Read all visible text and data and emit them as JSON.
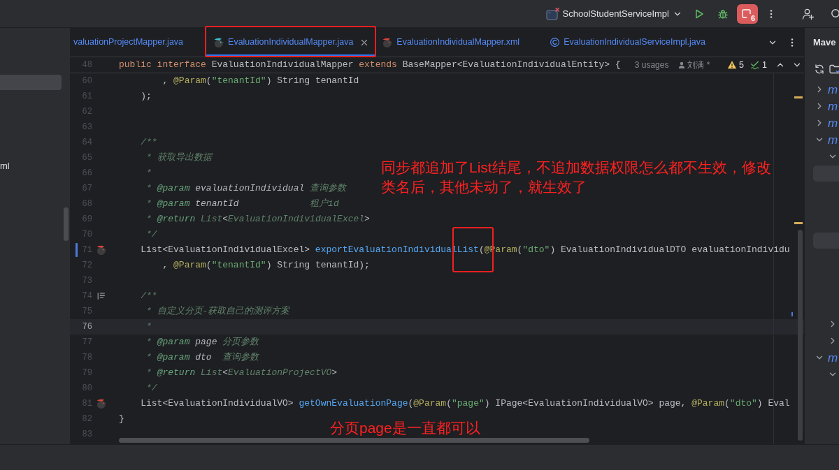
{
  "toolbar": {
    "run_configuration": "SchoolStudentServiceImpl",
    "stop_count": "6"
  },
  "project_panel": {
    "rows": [
      {
        "selected": true
      },
      {
        "selected": false
      },
      {
        "selected": false
      },
      {
        "selected": false
      },
      {
        "selected": false
      },
      {
        "label": "ml",
        "selected": false
      }
    ]
  },
  "editor_tabs": [
    {
      "label": "valuationProjectMapper.java",
      "kind": "plain",
      "selected": false,
      "framed": false
    },
    {
      "label": "EvaluationIndividualMapper.java",
      "kind": "mapper",
      "selected": true,
      "framed": true
    },
    {
      "label": "EvaluationIndividualMapper.xml",
      "kind": "mapper-xml",
      "selected": false,
      "framed": false
    },
    {
      "label": "EvaluationIndividualServiceImpl.java",
      "kind": "class",
      "selected": false,
      "framed": false
    }
  ],
  "sticky_line": {
    "number": "48",
    "segments": [
      {
        "kind": "keyword",
        "text": "public interface "
      },
      {
        "kind": "plain",
        "text": "EvaluationIndividualMapper "
      },
      {
        "kind": "keyword",
        "text": "extends "
      },
      {
        "kind": "plain",
        "text": "BaseMapper<EvaluationIndividualEntity> {"
      }
    ],
    "usages": "3 usages",
    "author": "刘满 *"
  },
  "inspections": {
    "warnings": "5",
    "passed": "1"
  },
  "lines": [
    {
      "number": "60",
      "current": false,
      "changed": false,
      "segments": [
        {
          "kind": "plain",
          "text": "        , "
        },
        {
          "kind": "annotation",
          "text": "@Param"
        },
        {
          "kind": "plain",
          "text": "("
        },
        {
          "kind": "string",
          "text": "\"tenantId\""
        },
        {
          "kind": "plain",
          "text": ") String tenantId"
        }
      ]
    },
    {
      "number": "61",
      "current": false,
      "changed": false,
      "segments": [
        {
          "kind": "plain",
          "text": "    );"
        }
      ]
    },
    {
      "number": "62",
      "current": false,
      "changed": false
    },
    {
      "number": "63",
      "current": false,
      "changed": false
    },
    {
      "number": "64",
      "current": false,
      "changed": false,
      "segments": [
        {
          "kind": "doc",
          "text": "    /**"
        }
      ]
    },
    {
      "number": "65",
      "current": false,
      "changed": false,
      "segments": [
        {
          "kind": "doc",
          "text": "     * 获取导出数据"
        }
      ]
    },
    {
      "number": "66",
      "current": false,
      "changed": false,
      "segments": [
        {
          "kind": "doc",
          "text": "     *"
        }
      ]
    },
    {
      "number": "67",
      "current": false,
      "changed": false,
      "segments": [
        {
          "kind": "doc",
          "text": "     * "
        },
        {
          "kind": "doctag",
          "text": "@param"
        },
        {
          "kind": "docvalue",
          "text": " evaluationIndividual "
        },
        {
          "kind": "doc",
          "text": "查询参数"
        }
      ]
    },
    {
      "number": "68",
      "current": false,
      "changed": false,
      "segments": [
        {
          "kind": "doc",
          "text": "     * "
        },
        {
          "kind": "doctag",
          "text": "@param"
        },
        {
          "kind": "docvalue",
          "text": " tenantId             "
        },
        {
          "kind": "doc",
          "text": "租户id"
        }
      ]
    },
    {
      "number": "69",
      "current": false,
      "changed": false,
      "segments": [
        {
          "kind": "doc",
          "text": "     * "
        },
        {
          "kind": "doctag",
          "text": "@return"
        },
        {
          "kind": "doc",
          "text": " List"
        },
        {
          "kind": "docvalue",
          "text": "<"
        },
        {
          "kind": "doc",
          "text": "EvaluationIndividualExcel"
        },
        {
          "kind": "docvalue",
          "text": ">"
        }
      ]
    },
    {
      "number": "70",
      "current": false,
      "changed": false,
      "segments": [
        {
          "kind": "doc",
          "text": "     */"
        }
      ]
    },
    {
      "number": "71",
      "current": false,
      "changed": true,
      "gutter_icon": {
        "kind": "mapper"
      },
      "segments": [
        {
          "kind": "plain",
          "text": "    List<EvaluationIndividualExcel> "
        },
        {
          "kind": "method",
          "text": "exportEvaluationIndividual"
        },
        {
          "kind": "method",
          "text": "List",
          "framed": true
        },
        {
          "kind": "plain",
          "text": "("
        },
        {
          "kind": "annotation",
          "text": "@Param"
        },
        {
          "kind": "plain",
          "text": "("
        },
        {
          "kind": "string",
          "text": "\"dto\""
        },
        {
          "kind": "plain",
          "text": ") EvaluationIndividualDTO evaluationIndividu"
        }
      ]
    },
    {
      "number": "72",
      "current": false,
      "changed": false,
      "segments": [
        {
          "kind": "plain",
          "text": "        , "
        },
        {
          "kind": "annotation",
          "text": "@Param"
        },
        {
          "kind": "plain",
          "text": "("
        },
        {
          "kind": "string",
          "text": "\"tenantId\""
        },
        {
          "kind": "plain",
          "text": ") String tenantId);"
        }
      ]
    },
    {
      "number": "73",
      "current": false,
      "changed": false
    },
    {
      "number": "74",
      "current": false,
      "changed": false,
      "gutter_icon": {
        "kind": "doc"
      },
      "segments": [
        {
          "kind": "doc",
          "text": "    /**"
        }
      ]
    },
    {
      "number": "75",
      "current": false,
      "changed": false,
      "segments": [
        {
          "kind": "doc",
          "text": "     * 自定义分页-获取自己的测评方案"
        }
      ]
    },
    {
      "number": "76",
      "current": true,
      "changed": false,
      "segments": [
        {
          "kind": "doc",
          "text": "     *"
        }
      ]
    },
    {
      "number": "77",
      "current": false,
      "changed": false,
      "segments": [
        {
          "kind": "doc",
          "text": "     * "
        },
        {
          "kind": "doctag",
          "text": "@param"
        },
        {
          "kind": "docvalue",
          "text": " page "
        },
        {
          "kind": "doc",
          "text": "分页参数"
        }
      ]
    },
    {
      "number": "78",
      "current": false,
      "changed": false,
      "segments": [
        {
          "kind": "doc",
          "text": "     * "
        },
        {
          "kind": "doctag",
          "text": "@param"
        },
        {
          "kind": "docvalue",
          "text": " dto  "
        },
        {
          "kind": "doc",
          "text": "查询参数"
        }
      ]
    },
    {
      "number": "79",
      "current": false,
      "changed": false,
      "segments": [
        {
          "kind": "doc",
          "text": "     * "
        },
        {
          "kind": "doctag",
          "text": "@return"
        },
        {
          "kind": "doc",
          "text": " List"
        },
        {
          "kind": "docvalue",
          "text": "<"
        },
        {
          "kind": "doc",
          "text": "EvaluationProjectVO"
        },
        {
          "kind": "docvalue",
          "text": ">"
        }
      ]
    },
    {
      "number": "80",
      "current": false,
      "changed": false,
      "segments": [
        {
          "kind": "doc",
          "text": "     */"
        }
      ]
    },
    {
      "number": "81",
      "current": false,
      "changed": false,
      "gutter_icon": {
        "kind": "mapper"
      },
      "segments": [
        {
          "kind": "plain",
          "text": "    List<EvaluationIndividualVO> "
        },
        {
          "kind": "method",
          "text": "getOwnEvaluationPage"
        },
        {
          "kind": "plain",
          "text": "("
        },
        {
          "kind": "annotation",
          "text": "@Param"
        },
        {
          "kind": "plain",
          "text": "("
        },
        {
          "kind": "string",
          "text": "\"page\""
        },
        {
          "kind": "plain",
          "text": ") IPage<EvaluationIndividualVO> page, "
        },
        {
          "kind": "annotation",
          "text": "@Param"
        },
        {
          "kind": "plain",
          "text": "("
        },
        {
          "kind": "string",
          "text": "\"dto\""
        },
        {
          "kind": "plain",
          "text": ") Eval"
        }
      ]
    },
    {
      "number": "82",
      "current": false,
      "changed": false,
      "segments": [
        {
          "kind": "plain",
          "text": "}"
        }
      ]
    },
    {
      "number": "83",
      "current": false,
      "changed": false
    }
  ],
  "annotations": [
    {
      "text": "同步都追加了List结尾，不追加数据权限怎么都不生效，修改类名后，其他未动了，就生效了"
    },
    {
      "text": "分页page是一直都可以"
    }
  ],
  "maven": {
    "title": "Mave",
    "tree": [
      {
        "glyph": "m",
        "expanded": false
      },
      {
        "glyph": "m",
        "expanded": false
      },
      {
        "glyph": "m",
        "expanded": false
      },
      {
        "glyph": "m",
        "expanded": true,
        "children": [
          {
            "expanded": true,
            "children": [
              {
                "selected": true
              },
              {
                "selected": false
              },
              {
                "selected": false
              },
              {
                "selected": false
              },
              {
                "selected": true
              },
              {
                "selected": false
              },
              {
                "selected": false
              },
              {
                "selected": false
              },
              {
                "selected": false
              }
            ]
          },
          {
            "expanded": false
          },
          {
            "expanded": false
          }
        ]
      },
      {
        "glyph": "m",
        "expanded": true,
        "children": [
          {
            "expanded": true
          }
        ]
      }
    ]
  }
}
